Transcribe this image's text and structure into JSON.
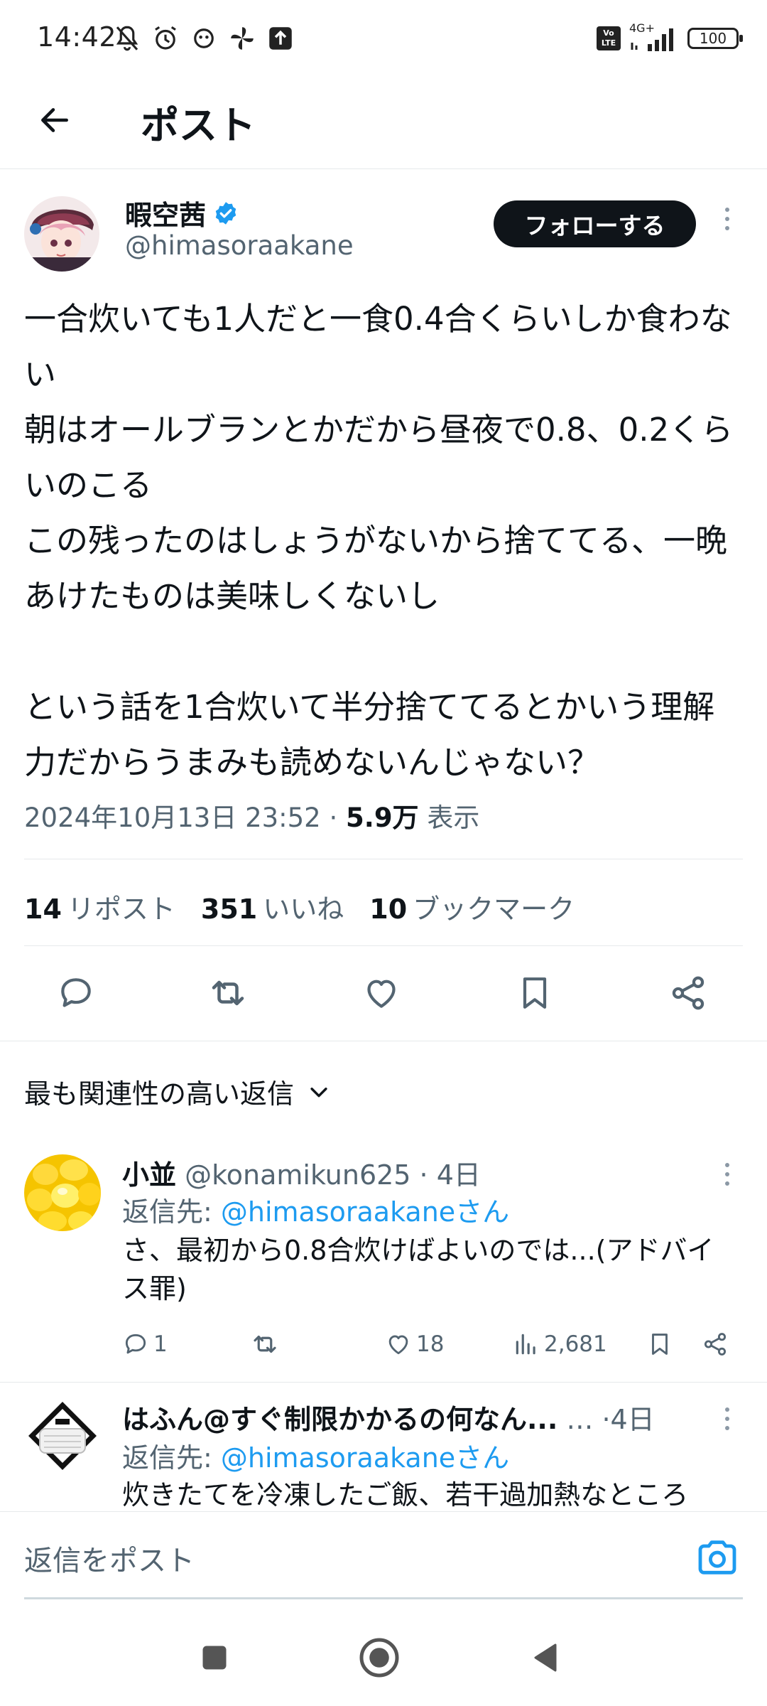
{
  "status_bar": {
    "time": "14:42",
    "network": "4G+",
    "battery": "100"
  },
  "header": {
    "title": "ポスト"
  },
  "post": {
    "author_name": "暇空茜",
    "author_handle": "@himasoraakane",
    "follow_label": "フォローする",
    "text": "一合炊いても1人だと一食0.4合くらいしか食わない\n朝はオールブランとかだから昼夜で0.8、0.2くらいのこる\nこの残ったのはしょうがないから捨ててる、一晩あけたものは美味しくないし\n\nという話を1合炊いて半分捨ててるとかいう理解力だからうまみも読めないんじゃない？",
    "timestamp": "2024年10月13日 23:52",
    "separator": " · ",
    "views_count": "5.9万",
    "views_label": " 表示"
  },
  "stats": {
    "reposts_count": "14",
    "reposts_label": "リポスト",
    "likes_count": "351",
    "likes_label": "いいね",
    "bookmarks_count": "10",
    "bookmarks_label": "ブックマーク"
  },
  "replies_sort": {
    "label": "最も関連性の高い返信"
  },
  "replies": [
    {
      "name": "小並",
      "handle": " @konamikun625 · 4日",
      "reply_prefix": "返信先: ",
      "reply_target": "@himasoraakaneさん",
      "text": "さ、最初から0.8合炊けばよいのでは...(アドバイス罪)",
      "reply_count": "1",
      "like_count": "18",
      "view_count": "2,681"
    },
    {
      "name": "はふん@すぐ制限かかるの何なん...",
      "handle": " … ·4日",
      "reply_prefix": "返信先: ",
      "reply_target": "@himasoraakaneさん",
      "text": "炊きたてを冷凍したご飯、若干過加熱なところ"
    }
  ],
  "compose": {
    "placeholder": "返信をポスト"
  },
  "colors": {
    "accent": "#1d9bf0",
    "text": "#0f1419",
    "secondary": "#536471",
    "verified": "#1d9bf0"
  }
}
